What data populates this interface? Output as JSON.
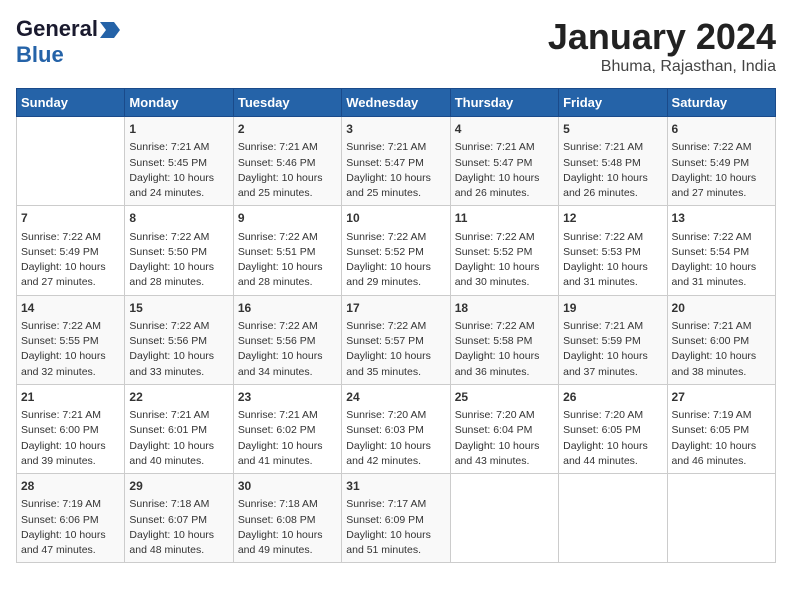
{
  "logo": {
    "line1": "General",
    "arrow": "▶",
    "line2": "Blue"
  },
  "title": "January 2024",
  "subtitle": "Bhuma, Rajasthan, India",
  "headers": [
    "Sunday",
    "Monday",
    "Tuesday",
    "Wednesday",
    "Thursday",
    "Friday",
    "Saturday"
  ],
  "weeks": [
    [
      {
        "day": "",
        "lines": []
      },
      {
        "day": "1",
        "lines": [
          "Sunrise: 7:21 AM",
          "Sunset: 5:45 PM",
          "Daylight: 10 hours",
          "and 24 minutes."
        ]
      },
      {
        "day": "2",
        "lines": [
          "Sunrise: 7:21 AM",
          "Sunset: 5:46 PM",
          "Daylight: 10 hours",
          "and 25 minutes."
        ]
      },
      {
        "day": "3",
        "lines": [
          "Sunrise: 7:21 AM",
          "Sunset: 5:47 PM",
          "Daylight: 10 hours",
          "and 25 minutes."
        ]
      },
      {
        "day": "4",
        "lines": [
          "Sunrise: 7:21 AM",
          "Sunset: 5:47 PM",
          "Daylight: 10 hours",
          "and 26 minutes."
        ]
      },
      {
        "day": "5",
        "lines": [
          "Sunrise: 7:21 AM",
          "Sunset: 5:48 PM",
          "Daylight: 10 hours",
          "and 26 minutes."
        ]
      },
      {
        "day": "6",
        "lines": [
          "Sunrise: 7:22 AM",
          "Sunset: 5:49 PM",
          "Daylight: 10 hours",
          "and 27 minutes."
        ]
      }
    ],
    [
      {
        "day": "7",
        "lines": [
          "Sunrise: 7:22 AM",
          "Sunset: 5:49 PM",
          "Daylight: 10 hours",
          "and 27 minutes."
        ]
      },
      {
        "day": "8",
        "lines": [
          "Sunrise: 7:22 AM",
          "Sunset: 5:50 PM",
          "Daylight: 10 hours",
          "and 28 minutes."
        ]
      },
      {
        "day": "9",
        "lines": [
          "Sunrise: 7:22 AM",
          "Sunset: 5:51 PM",
          "Daylight: 10 hours",
          "and 28 minutes."
        ]
      },
      {
        "day": "10",
        "lines": [
          "Sunrise: 7:22 AM",
          "Sunset: 5:52 PM",
          "Daylight: 10 hours",
          "and 29 minutes."
        ]
      },
      {
        "day": "11",
        "lines": [
          "Sunrise: 7:22 AM",
          "Sunset: 5:52 PM",
          "Daylight: 10 hours",
          "and 30 minutes."
        ]
      },
      {
        "day": "12",
        "lines": [
          "Sunrise: 7:22 AM",
          "Sunset: 5:53 PM",
          "Daylight: 10 hours",
          "and 31 minutes."
        ]
      },
      {
        "day": "13",
        "lines": [
          "Sunrise: 7:22 AM",
          "Sunset: 5:54 PM",
          "Daylight: 10 hours",
          "and 31 minutes."
        ]
      }
    ],
    [
      {
        "day": "14",
        "lines": [
          "Sunrise: 7:22 AM",
          "Sunset: 5:55 PM",
          "Daylight: 10 hours",
          "and 32 minutes."
        ]
      },
      {
        "day": "15",
        "lines": [
          "Sunrise: 7:22 AM",
          "Sunset: 5:56 PM",
          "Daylight: 10 hours",
          "and 33 minutes."
        ]
      },
      {
        "day": "16",
        "lines": [
          "Sunrise: 7:22 AM",
          "Sunset: 5:56 PM",
          "Daylight: 10 hours",
          "and 34 minutes."
        ]
      },
      {
        "day": "17",
        "lines": [
          "Sunrise: 7:22 AM",
          "Sunset: 5:57 PM",
          "Daylight: 10 hours",
          "and 35 minutes."
        ]
      },
      {
        "day": "18",
        "lines": [
          "Sunrise: 7:22 AM",
          "Sunset: 5:58 PM",
          "Daylight: 10 hours",
          "and 36 minutes."
        ]
      },
      {
        "day": "19",
        "lines": [
          "Sunrise: 7:21 AM",
          "Sunset: 5:59 PM",
          "Daylight: 10 hours",
          "and 37 minutes."
        ]
      },
      {
        "day": "20",
        "lines": [
          "Sunrise: 7:21 AM",
          "Sunset: 6:00 PM",
          "Daylight: 10 hours",
          "and 38 minutes."
        ]
      }
    ],
    [
      {
        "day": "21",
        "lines": [
          "Sunrise: 7:21 AM",
          "Sunset: 6:00 PM",
          "Daylight: 10 hours",
          "and 39 minutes."
        ]
      },
      {
        "day": "22",
        "lines": [
          "Sunrise: 7:21 AM",
          "Sunset: 6:01 PM",
          "Daylight: 10 hours",
          "and 40 minutes."
        ]
      },
      {
        "day": "23",
        "lines": [
          "Sunrise: 7:21 AM",
          "Sunset: 6:02 PM",
          "Daylight: 10 hours",
          "and 41 minutes."
        ]
      },
      {
        "day": "24",
        "lines": [
          "Sunrise: 7:20 AM",
          "Sunset: 6:03 PM",
          "Daylight: 10 hours",
          "and 42 minutes."
        ]
      },
      {
        "day": "25",
        "lines": [
          "Sunrise: 7:20 AM",
          "Sunset: 6:04 PM",
          "Daylight: 10 hours",
          "and 43 minutes."
        ]
      },
      {
        "day": "26",
        "lines": [
          "Sunrise: 7:20 AM",
          "Sunset: 6:05 PM",
          "Daylight: 10 hours",
          "and 44 minutes."
        ]
      },
      {
        "day": "27",
        "lines": [
          "Sunrise: 7:19 AM",
          "Sunset: 6:05 PM",
          "Daylight: 10 hours",
          "and 46 minutes."
        ]
      }
    ],
    [
      {
        "day": "28",
        "lines": [
          "Sunrise: 7:19 AM",
          "Sunset: 6:06 PM",
          "Daylight: 10 hours",
          "and 47 minutes."
        ]
      },
      {
        "day": "29",
        "lines": [
          "Sunrise: 7:18 AM",
          "Sunset: 6:07 PM",
          "Daylight: 10 hours",
          "and 48 minutes."
        ]
      },
      {
        "day": "30",
        "lines": [
          "Sunrise: 7:18 AM",
          "Sunset: 6:08 PM",
          "Daylight: 10 hours",
          "and 49 minutes."
        ]
      },
      {
        "day": "31",
        "lines": [
          "Sunrise: 7:17 AM",
          "Sunset: 6:09 PM",
          "Daylight: 10 hours",
          "and 51 minutes."
        ]
      },
      {
        "day": "",
        "lines": []
      },
      {
        "day": "",
        "lines": []
      },
      {
        "day": "",
        "lines": []
      }
    ]
  ]
}
